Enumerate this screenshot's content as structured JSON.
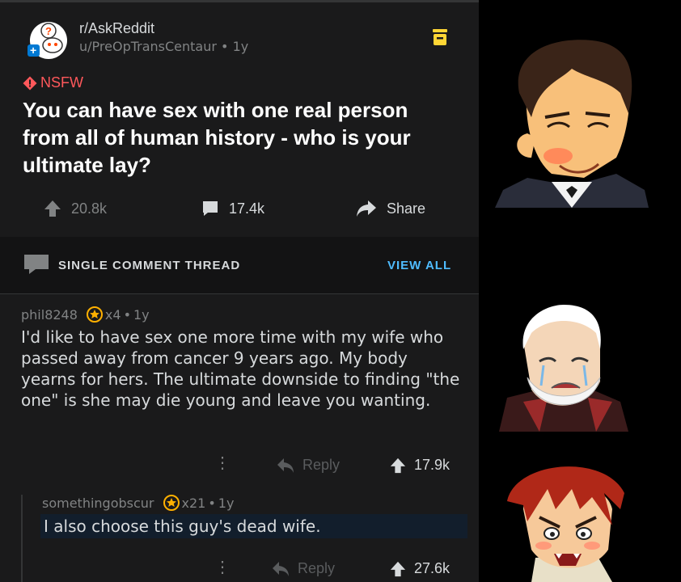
{
  "post": {
    "subreddit": "r/AskReddit",
    "author": "u/PreOpTransCentaur",
    "age": "1y",
    "nsfw_label": "NSFW",
    "title": "You can have sex with one real person from all of human history - who is your ultimate lay?",
    "upvotes": "20.8k",
    "comments": "17.4k",
    "share_label": "Share"
  },
  "thread_bar": {
    "label": "SINGLE COMMENT THREAD",
    "view_all": "VIEW ALL"
  },
  "comments": [
    {
      "author": "phil8248",
      "award_count": "x4",
      "age": "1y",
      "body": "I'd like to have sex one more time with my wife who passed away from cancer 9 years ago. My body yearns for hers. The ultimate downside to finding \"the one\" is she may die young and leave you wanting.",
      "reply_label": "Reply",
      "votes": "17.9k"
    },
    {
      "author": "somethingobscur",
      "award_count": "x21",
      "age": "1y",
      "body": "I also choose this guy's dead wife.",
      "reply_label": "Reply",
      "votes": "27.6k"
    }
  ],
  "colors": {
    "background": "#1a1a1b",
    "nsfw": "#ff585b",
    "link": "#4fbcff",
    "award": "#ffb000",
    "save_icon": "#ffd635"
  },
  "icons": [
    "subreddit-avatar-icon",
    "save-icon",
    "nsfw-icon",
    "upvote-icon",
    "comment-icon",
    "share-icon",
    "chat-icon",
    "award-icon",
    "more-icon",
    "reply-icon"
  ]
}
